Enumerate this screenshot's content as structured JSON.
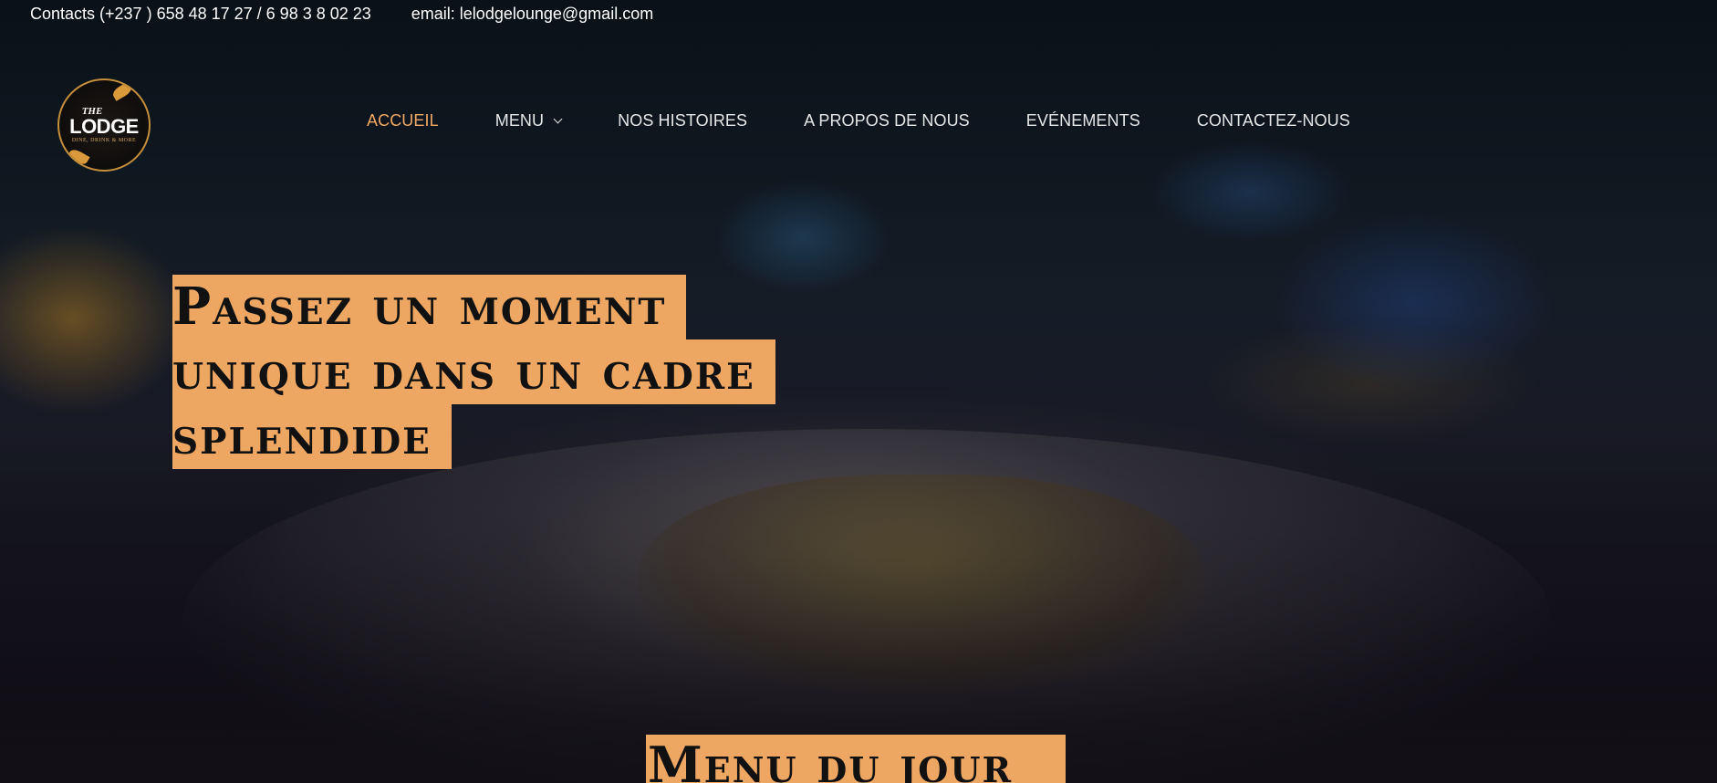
{
  "topbar": {
    "contacts": "Contacts (+237 ) 658 48 17 27 / 6 98 3 8 02 23",
    "email": "email: lelodgelounge@gmail.com"
  },
  "logo": {
    "the": "THE",
    "name": "LODGE",
    "tagline": "DINE, DRINK & MORE"
  },
  "nav": {
    "items": [
      {
        "label": "ACCUEIL",
        "active": true
      },
      {
        "label": "MENU",
        "has_dropdown": true
      },
      {
        "label": "NOS HISTOIRES"
      },
      {
        "label": "A PROPOS DE NOUS"
      },
      {
        "label": "EVÉNEMENTS"
      },
      {
        "label": "CONTACTEZ-NOUS"
      }
    ],
    "active_color": "#f0a965"
  },
  "hero": {
    "headline_lines": [
      "Passez un moment",
      "unique dans un cadre",
      "splendide"
    ],
    "highlight_color": "#eea763"
  },
  "section": {
    "title": "Menu du jour"
  }
}
